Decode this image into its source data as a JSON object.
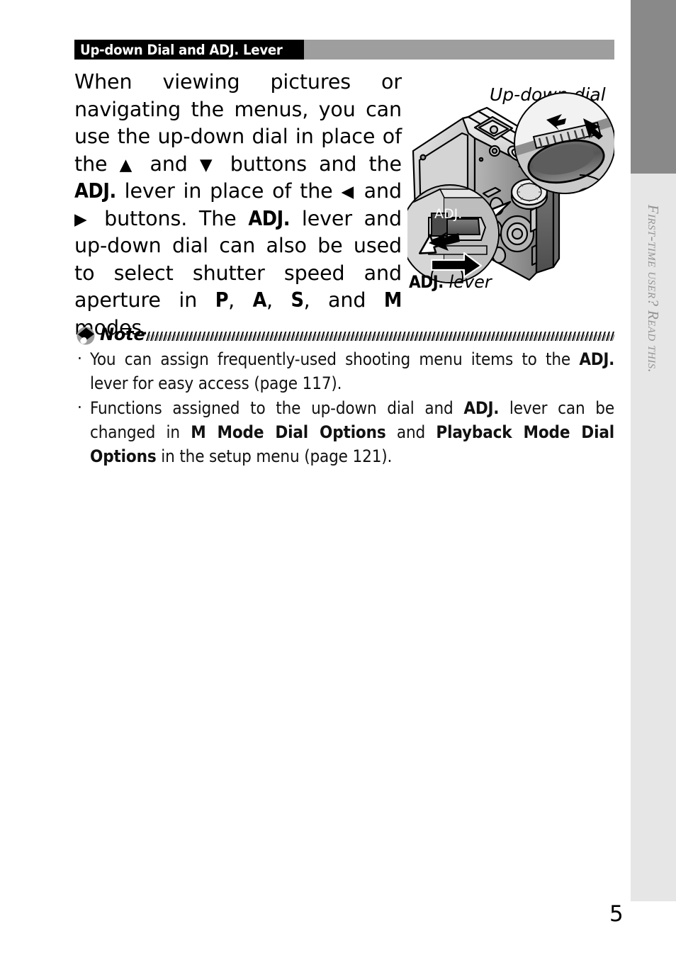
{
  "page": {
    "number": "5",
    "side_tab": "First-time user? Read this."
  },
  "section": {
    "header_title": "Up-down Dial and ADJ. Lever"
  },
  "intro": {
    "p1_a": "When viewing pictures or navigating the menus, you can use the up-down dial in place of the ",
    "tri_up": "▲",
    "p1_b": " and ",
    "tri_down": "▼",
    "p1_c": " buttons and the ",
    "kw_adj_1": "ADJ.",
    "p1_d": " lever in place of the ",
    "tri_left": "◀",
    "p1_e": " and ",
    "tri_right": "▶",
    "p1_f": " buttons. The ",
    "kw_adj_2": "ADJ.",
    "p1_g": " lever and up-down dial can also be used to select shutter speed and aperture in ",
    "kw_p": "P",
    "p1_h": ", ",
    "kw_a": "A",
    "p1_i": ", ",
    "kw_s": "S",
    "p1_j": ", and ",
    "kw_m": "M",
    "p1_k": " modes."
  },
  "illustration": {
    "caption_updown_dial": "Up-down dial",
    "caption_adj_bold": "ADJ.",
    "caption_adj_italic": "lever",
    "callout_adj_label": "ADJ."
  },
  "note": {
    "label": "Note",
    "bullets": [
      {
        "a": "You can assign frequently-used shooting menu items to the ",
        "kw1": "ADJ.",
        "b": " lever for easy access (page 117)."
      },
      {
        "a": "Functions assigned to the up-down dial and ",
        "kw1": "ADJ.",
        "b": " lever can be changed in ",
        "kw2": "M Mode Dial Options",
        "c": " and ",
        "kw3": "Playback Mode Dial Options",
        "d": " in the setup menu (page 121)."
      }
    ]
  },
  "colors": {
    "header_black": "#000000",
    "header_gray": "#9e9e9e",
    "side_tab_dark": "#898989",
    "side_tab_light": "#e6e6e6",
    "text": "#000000"
  }
}
